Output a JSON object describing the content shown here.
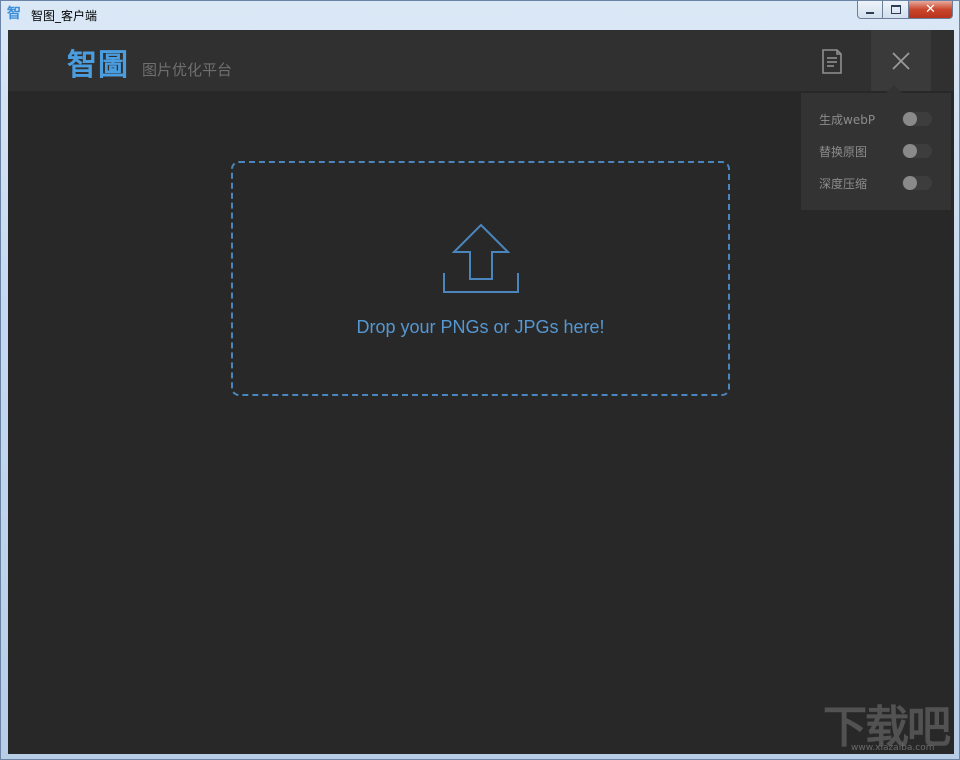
{
  "window": {
    "title": "智图_客户端",
    "icon": "智",
    "close_glyph": "✕"
  },
  "header": {
    "logo": "智圖",
    "subtitle": "图片优化平台",
    "doc_icon": "document-icon",
    "close_icon": "close-icon"
  },
  "settings": {
    "items": [
      {
        "label": "生成webP",
        "enabled": false
      },
      {
        "label": "替换原图",
        "enabled": false
      },
      {
        "label": "深度压缩",
        "enabled": false
      }
    ]
  },
  "dropzone": {
    "text": "Drop your PNGs or JPGs here!",
    "icon": "upload-arrow-icon"
  },
  "watermark": {
    "text": "下载吧",
    "url": "www.xiazaiba.com"
  },
  "colors": {
    "accent": "#4a9ddf",
    "background": "#282828",
    "header": "#303030",
    "dropzone_border": "#4a86bd"
  }
}
